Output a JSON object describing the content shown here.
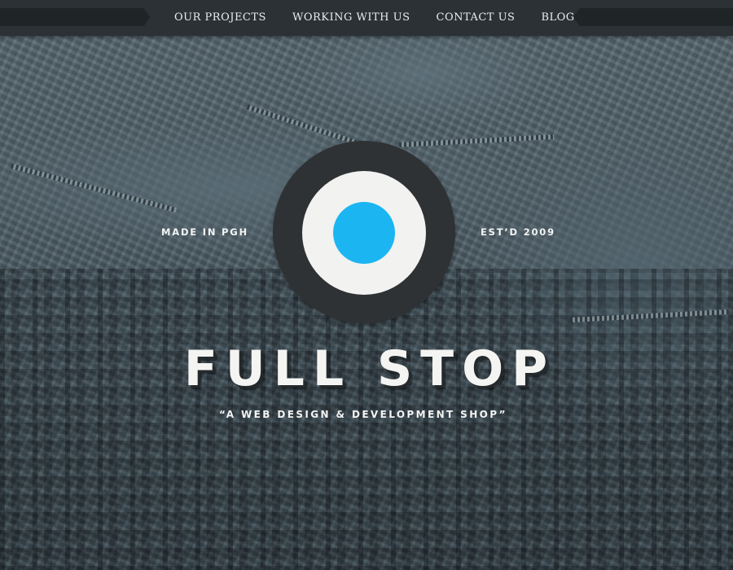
{
  "nav": {
    "items": [
      {
        "label": "OUR PROJECTS"
      },
      {
        "label": "WORKING WITH US"
      },
      {
        "label": "CONTACT US"
      },
      {
        "label": "BLOG"
      }
    ]
  },
  "hero": {
    "tag_left": "MADE IN PGH",
    "tag_right": "EST’D 2009",
    "title": "FULL STOP",
    "subtitle": "“A WEB DESIGN & DEVELOPMENT SHOP”"
  },
  "colors": {
    "accent": "#1bb6f2",
    "nav_bg": "#2b3135",
    "logo_ring": "#2f3235",
    "logo_white": "#f2f2f0"
  },
  "icons": {
    "logo": "target-logo-icon"
  }
}
